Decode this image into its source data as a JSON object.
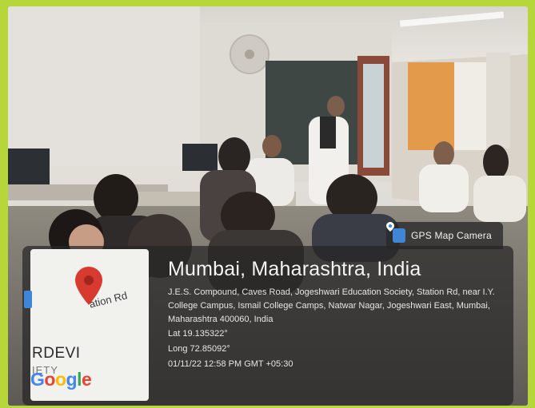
{
  "badge": {
    "label": "GPS Map Camera",
    "icon": "map-pin-icon",
    "accent": "#3f86d9"
  },
  "map": {
    "road_label": "ation Rd",
    "area_label": "RDEVI",
    "area_label_2": "IETY",
    "logo_text": "Google",
    "pin_color": "#d93a2f"
  },
  "location": {
    "city": "Mumbai, Maharashtra, India",
    "address": "J.E.S. Compound, Caves Road, Jogeshwari Education Society, Station Rd, near I.Y. College Campus, Ismail College Camps, Natwar Nagar, Jogeshwari East, Mumbai, Maharashtra 400060, India",
    "lat": "Lat 19.135322°",
    "long": "Long 72.85092°",
    "datetime": "01/11/22 12:58 PM GMT +05:30"
  },
  "colors": {
    "frame": "#b6d63a",
    "overlay": "#262626"
  }
}
